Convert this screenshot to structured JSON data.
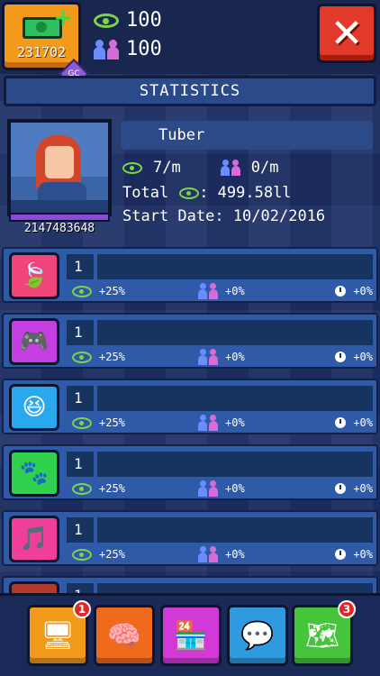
{
  "header": {
    "money": "231702",
    "views": "100",
    "subscribers": "100",
    "gc_badge": "GC"
  },
  "title": "STATISTICS",
  "profile": {
    "name": "Tuber",
    "views_rate": "7/m",
    "subs_rate": "0/m",
    "total_label": "Total",
    "total_value": ": 499.58ll",
    "start_date": "Start Date: 10/02/2016",
    "sub_count": "2147483648"
  },
  "categories": [
    {
      "icon": "leaf-icon",
      "color": "#f0457a",
      "glyph": "🍃",
      "level": "1",
      "views_bonus": "+25%",
      "subs_bonus": "+0%",
      "time_bonus": "+0%"
    },
    {
      "icon": "gamepad-icon",
      "color": "#c43fe0",
      "glyph": "🎮",
      "level": "1",
      "views_bonus": "+25%",
      "subs_bonus": "+0%",
      "time_bonus": "+0%"
    },
    {
      "icon": "laugh-icon",
      "color": "#2aa8ee",
      "glyph": "😆",
      "level": "1",
      "views_bonus": "+25%",
      "subs_bonus": "+0%",
      "time_bonus": "+0%"
    },
    {
      "icon": "paw-icon",
      "color": "#2fd04e",
      "glyph": "🐾",
      "level": "1",
      "views_bonus": "+25%",
      "subs_bonus": "+0%",
      "time_bonus": "+0%"
    },
    {
      "icon": "music-icon",
      "color": "#ef3f9a",
      "glyph": "🎵",
      "level": "1",
      "views_bonus": "+25%",
      "subs_bonus": "+0%",
      "time_bonus": "+0%"
    },
    {
      "icon": "partial-icon",
      "color": "#b13a2a",
      "glyph": "",
      "level": "1",
      "views_bonus": "",
      "subs_bonus": "",
      "time_bonus": ""
    }
  ],
  "nav": [
    {
      "name": "computer-nav-button",
      "icon": "computer-icon",
      "glyph": "🖥",
      "color": "#f39a1d",
      "badge": "1"
    },
    {
      "name": "upgrade-nav-button",
      "icon": "brain-icon",
      "glyph": "🧠",
      "color": "#f06a1e",
      "badge": ""
    },
    {
      "name": "shop-nav-button",
      "icon": "shop-icon",
      "glyph": "🏪",
      "color": "#d23ad8",
      "badge": ""
    },
    {
      "name": "social-nav-button",
      "icon": "people-icon",
      "glyph": "💬",
      "color": "#2f9ae0",
      "badge": ""
    },
    {
      "name": "map-nav-button",
      "icon": "map-icon",
      "glyph": "🗺",
      "color": "#46c43a",
      "badge": "3"
    }
  ]
}
